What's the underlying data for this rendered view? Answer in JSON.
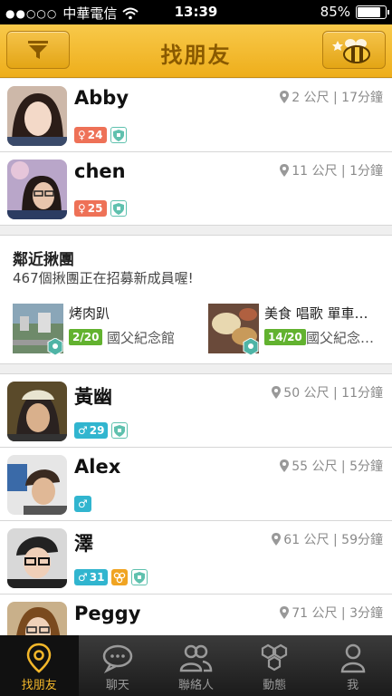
{
  "status": {
    "carrier": "中華電信",
    "time": "13:39",
    "battery": "85%",
    "battery_fraction": 0.85
  },
  "nav": {
    "title": "找朋友"
  },
  "users": [
    {
      "name": "Abby",
      "distance": "2 公尺 | 17分鐘",
      "gender": "♀",
      "age": "24",
      "extra_badge": false
    },
    {
      "name": "chen",
      "distance": "11 公尺 | 1分鐘",
      "gender": "♀",
      "age": "25",
      "extra_badge": false
    }
  ],
  "groups_section": {
    "title": "鄰近揪團",
    "subtitle": "467個揪團正在招募新成員喔!",
    "groups": [
      {
        "name": "烤肉趴",
        "count": "2/20",
        "place": "國父紀念館"
      },
      {
        "name": "美食 唱歌 單車…",
        "count": "14/20",
        "place": "國父紀念…"
      }
    ]
  },
  "users2": [
    {
      "name": "黃幽",
      "distance": "50 公尺 | 11分鐘",
      "gender": "♂",
      "age": "29"
    },
    {
      "name": "Alex",
      "distance": "55 公尺 | 5分鐘",
      "gender": "♂",
      "age": ""
    },
    {
      "name": "澤",
      "distance": "61 公尺 | 59分鐘",
      "gender": "♂",
      "age": "31"
    },
    {
      "name": "Peggy",
      "distance": "71 公尺 | 3分鐘",
      "gender": "",
      "age": ""
    }
  ],
  "tabs": [
    {
      "label": "找朋友",
      "icon": "location-pin-icon",
      "active": true
    },
    {
      "label": "聊天",
      "icon": "chat-bubble-icon",
      "active": false
    },
    {
      "label": "聯絡人",
      "icon": "contacts-icon",
      "active": false
    },
    {
      "label": "動態",
      "icon": "hexagons-icon",
      "active": false
    },
    {
      "label": "我",
      "icon": "person-icon",
      "active": false
    }
  ],
  "colors": {
    "nav": "#f2b730",
    "female": "#ee7157",
    "male": "#31b5cf",
    "group_count": "#62b22f",
    "active_tab": "#f3b72a"
  }
}
